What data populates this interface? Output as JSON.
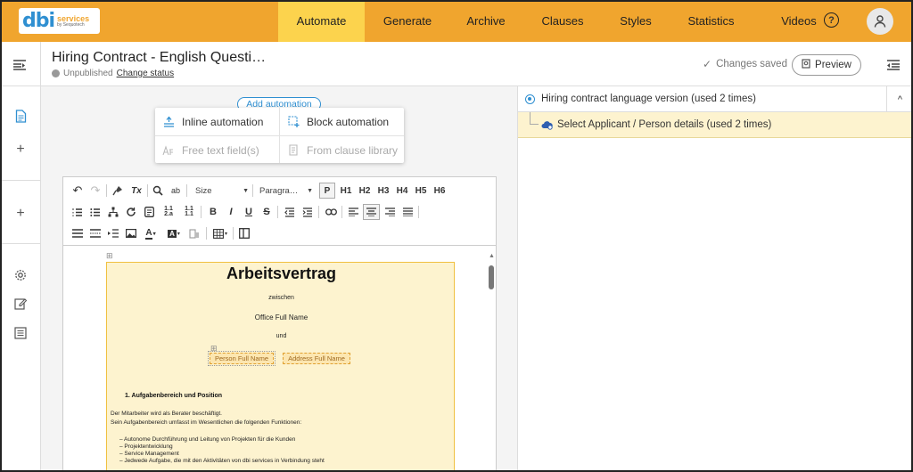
{
  "nav": {
    "logo": {
      "mark": "dbi",
      "line1": "services",
      "line2": "by Sequotech"
    },
    "tabs": [
      {
        "label": "Automate",
        "active": true
      },
      {
        "label": "Generate"
      },
      {
        "label": "Archive"
      },
      {
        "label": "Clauses"
      },
      {
        "label": "Styles"
      },
      {
        "label": "Statistics"
      },
      {
        "label": "Videos"
      }
    ],
    "help_icon": "?",
    "accent_color": "#f0a52e"
  },
  "header": {
    "title": "Hiring Contract - English Questi…",
    "status": "Unpublished",
    "change_status": "Change status",
    "saved_text": "Changes saved",
    "preview_label": "Preview"
  },
  "left_rail": {
    "icons": [
      "document-icon",
      "plus-icon",
      "plus-icon",
      "gear-icon",
      "edit-icon",
      "list-icon"
    ]
  },
  "automation": {
    "add_label": "Add automation",
    "options": [
      {
        "label": "Inline automation",
        "enabled": true
      },
      {
        "label": "Block automation",
        "enabled": true
      },
      {
        "label": "Free text field(s)",
        "enabled": false
      },
      {
        "label": "From clause library",
        "enabled": false
      }
    ]
  },
  "toolbar": {
    "size_label": "Size",
    "paragraph_label": "Paragra…",
    "headings": [
      "P",
      "H1",
      "H2",
      "H3",
      "H4",
      "H5",
      "H6"
    ],
    "format_buttons": [
      "B",
      "I",
      "U",
      "S"
    ],
    "undo": "↶",
    "redo": "↷",
    "clear_format": "Tx",
    "find_replace": "ab"
  },
  "document": {
    "title": "Arbeitsvertrag",
    "between": "zwischen",
    "office": "Office Full Name",
    "and": "und",
    "fields": [
      "Person Full Name",
      "Address Full Name"
    ],
    "section1": "1.    Aufgabenbereich und Position",
    "para1": "Der Mitarbeiter wird als Berater beschäftigt.",
    "para2": "Sein Aufgabenbereich umfasst im Wesentlichen die folgenden Funktionen:",
    "bullets": [
      "–    Autonome Durchführung und Leitung von Projekten für die Kunden",
      "–    Projektentwicklung",
      "–    Service Management",
      "–    Jedwede Aufgabe, die mit den Aktivitäten von dbi services in Verbindung steht"
    ]
  },
  "right_panel": {
    "item1": "Hiring contract language version (used 2 times)",
    "item2": "Select Applicant / Person details (used 2 times)",
    "collapse": "^"
  }
}
